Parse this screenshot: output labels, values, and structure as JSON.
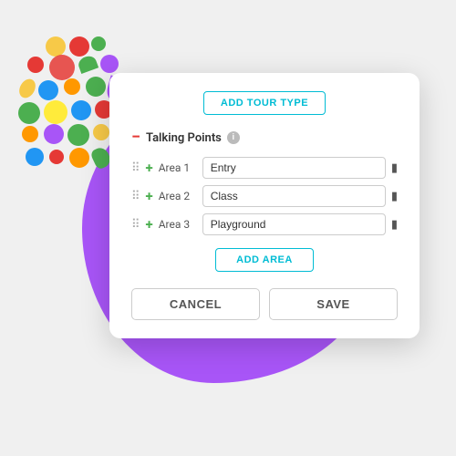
{
  "background": {
    "blob_color": "#a855f7"
  },
  "dialog": {
    "add_tour_btn_label": "ADD TOUR TYPE",
    "section": {
      "title": "Talking Points",
      "info_symbol": "i",
      "minus_symbol": "−"
    },
    "areas": [
      {
        "label": "Area 1",
        "value": "Entry"
      },
      {
        "label": "Area 2",
        "value": "Class"
      },
      {
        "label": "Area 3",
        "value": "Playground"
      }
    ],
    "add_area_btn_label": "ADD AREA",
    "cancel_label": "CANCEL",
    "save_label": "SAVE"
  },
  "icons": {
    "drag": "⠿",
    "plus": "+",
    "trash": "🗑",
    "minus": "−"
  }
}
